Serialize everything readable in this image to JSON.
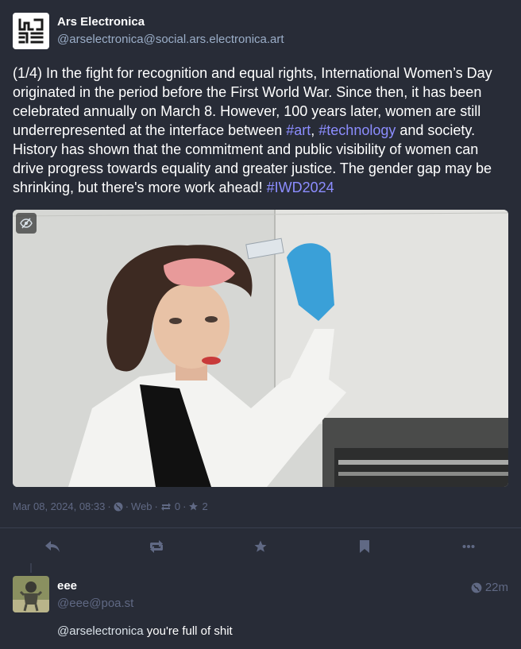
{
  "status": {
    "display_name": "Ars Electronica",
    "handle": "@arselectronica@social.ars.electronica.art",
    "content_text": "(1/4) In the fight for recognition and equal rights, International Women’s Day originated in the period before the First World War. Since then, it has been celebrated annually on March 8. However, 100 years later, women are still underrepresented at the interface between ",
    "tag_art": "#art",
    "sep": ", ",
    "tag_tech": "#technology",
    "content_text2": " and society. History has shown that the commitment and public visibility of women can drive progress towards equality and greater justice. The gender gap may be shrinking, but there's more work ahead! ",
    "tag_iwd": "#IWD2024",
    "date": "Mar 08, 2024, 08:33",
    "visibility_icon": "globe-icon",
    "application": "Web",
    "reblogs_count": "0",
    "favourites_count": "2"
  },
  "actions": {
    "reply_icon": "reply-icon",
    "boost_icon": "boost-icon",
    "favourite_icon": "star-icon",
    "bookmark_icon": "bookmark-icon",
    "more_icon": "more-icon"
  },
  "reply": {
    "display_name": "eee",
    "handle": "@eee@poa.st",
    "time": "22m",
    "mention": "@arselectronica",
    "text": " you're full of shit"
  },
  "colors": {
    "background": "#282c37",
    "hashtag": "#8c8dff",
    "muted": "#606984",
    "secondary": "#9baec8"
  }
}
